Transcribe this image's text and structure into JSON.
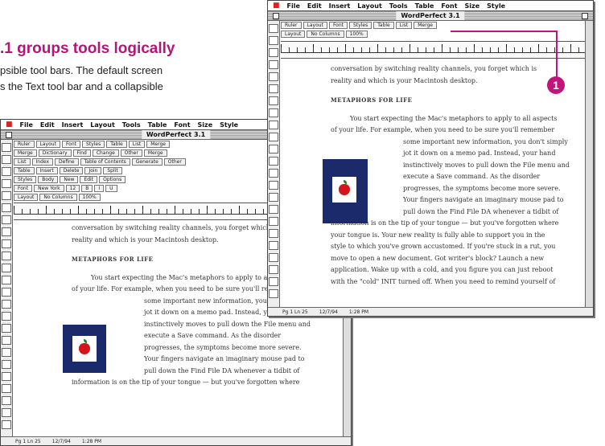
{
  "caption": {
    "heading": ".1 groups tools logically",
    "lines": [
      "psible tool bars. The default screen",
      "s the Text tool bar and a collapsible"
    ]
  },
  "menu": [
    "File",
    "Edit",
    "Insert",
    "Layout",
    "Tools",
    "Table",
    "Font",
    "Size",
    "Style"
  ],
  "window": {
    "title": "WordPerfect 3.1",
    "button_bar_tabs": [
      "Ruler",
      "Layout",
      "Font",
      "Styles",
      "Table",
      "List",
      "Merge"
    ],
    "back_button_bar_tabs": [
      "Ruler",
      "Layout",
      "Font",
      "Styles",
      "Table",
      "List",
      "Merge"
    ],
    "back_rows": [
      [
        "Merge",
        "Dictionary",
        "Find",
        "Change",
        "Other",
        "Merge"
      ],
      [
        "List",
        "Index",
        "Define",
        "Table of Contents",
        "Generate",
        "Other"
      ],
      [
        "Table",
        "Insert",
        "Delete",
        "Join",
        "Split"
      ],
      [
        "Styles",
        "Body",
        "New",
        "Edit",
        "Options"
      ],
      [
        "Font",
        "New York",
        "12",
        "B",
        "I",
        "U"
      ],
      [
        "Layout",
        "No Columns",
        "100%"
      ]
    ],
    "status": [
      "Pg 1 Ln 25",
      "12/7/94",
      "1:28 PM"
    ]
  },
  "document": {
    "opening": [
      "conversation by switching reality channels, you forget which is",
      "reality and which is your Macintosh desktop."
    ],
    "heading": "METAPHORS FOR LIFE",
    "front_body_top": [
      "You start expecting the Mac's metaphors to apply to all aspects",
      "of your life. For example, when you need to be sure you'll remember"
    ],
    "front_wrap": [
      "some important new information, you don't simply",
      "jot it down on a memo pad. Instead, your hand",
      "instinctively moves to pull down the File menu and",
      "execute a Save command. As the disorder",
      "progresses, the symptoms become more severe.",
      "Your fingers navigate an imaginary mouse pad to",
      "pull down the Find File DA whenever a tidbit of"
    ],
    "front_full": [
      "information is on the tip of your tongue — but you've forgotten where",
      "your tongue is. Your new reality is fully able to support you in the",
      "style to which you've grown accustomed. If you're stuck in a rut, you",
      "move to open a new document. Got writer's block? Launch a new",
      "application. Wake up with a cold, and you figure you can just reboot",
      "with the \"cold\" INIT turned off. When you need to remind yourself of"
    ],
    "back_body_top": [
      "You start expecting the Mac's metaphors to apply to al",
      "of your life. For example, when you need to be sure you'll re"
    ],
    "back_wrap": [
      "some important new information, you don't simply",
      "jot it down on a memo pad. Instead, your hand",
      "instinctively moves to pull down the File menu and",
      "execute a Save command. As the disorder",
      "progresses, the symptoms become more severe.",
      "Your fingers navigate an imaginary mouse pad to",
      "pull down the Find File DA whenever a tidbit of"
    ],
    "back_last": "information is on the tip of your tongue — but you've forgotten where"
  },
  "callout": {
    "number": "1",
    "color": "#c0157a"
  }
}
